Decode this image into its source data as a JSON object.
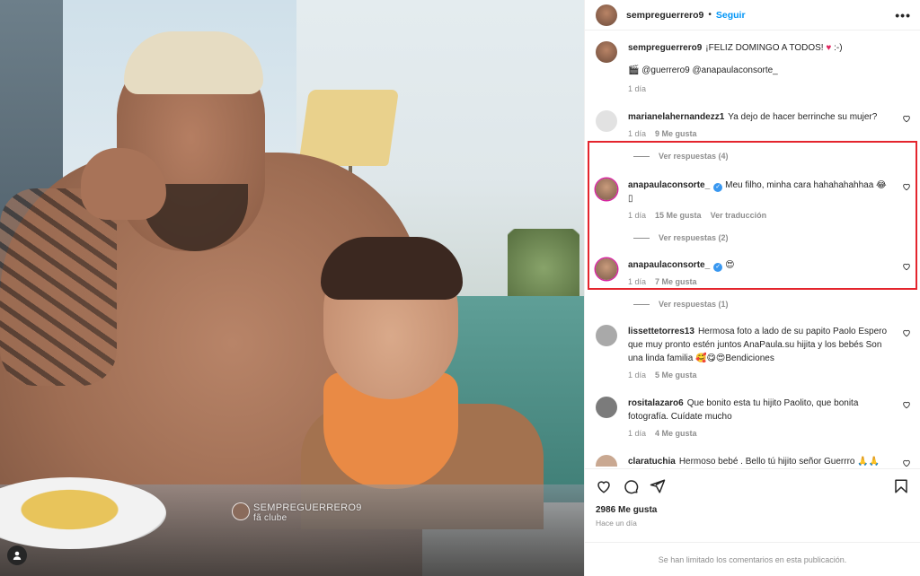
{
  "post": {
    "author": "sempreguerrero9",
    "follow_label": "Seguir",
    "more_label": "•••",
    "watermark_name": "SEMPREGUERRERO9",
    "watermark_sub": "fã clube"
  },
  "caption": {
    "user": "sempreguerrero9",
    "text": "¡FELIZ DOMINGO A TODOS! ",
    "emoji": "♥",
    "tail": " :-)",
    "mentions": "🎬 @guerrero9 @anapaulaconsorte_",
    "time": "1 día"
  },
  "comments": [
    {
      "user": "marianelahernandezz1",
      "text": "Ya dejo de hacer berrinche su mujer?",
      "time": "1 día",
      "likes": "9 Me gusta",
      "translate": "",
      "replies": "Ver respuestas (4)"
    },
    {
      "user": "anapaulaconsorte_",
      "verified": true,
      "text": "Meu filho, minha cara hahahahahhaa 😂",
      "text2": "▯",
      "time": "1 día",
      "likes": "15 Me gusta",
      "translate": "Ver traducción",
      "replies": "Ver respuestas (2)"
    },
    {
      "user": "anapaulaconsorte_",
      "verified": true,
      "text": "😍",
      "time": "1 día",
      "likes": "7 Me gusta",
      "translate": "",
      "replies": "Ver respuestas (1)"
    },
    {
      "user": "lissettetorres13",
      "text": "Hermosa foto a lado de su papito Paolo Espero que muy pronto estén juntos AnaPaula.su hijita y los bebés Son una linda familia 🥰😋😍Bendiciones",
      "time": "1 día",
      "likes": "5 Me gusta",
      "translate": "",
      "replies": ""
    },
    {
      "user": "rositalazaro6",
      "text": "Que bonito esta tu hijito Paolito, que bonita fotografía. Cuídate mucho",
      "time": "1 día",
      "likes": "4 Me gusta",
      "translate": "",
      "replies": ""
    },
    {
      "user": "claratuchia",
      "text": "Hermoso bebé . Bello tú hijito señor Guerrro 🙏🙏",
      "time": "",
      "likes": "",
      "translate": "",
      "replies": ""
    }
  ],
  "footer": {
    "likes": "2986 Me gusta",
    "time": "Hace un día",
    "limited": "Se han limitado los comentarios en esta publicación."
  },
  "colors": {
    "accent": "#0095f6",
    "highlight": "#e4252d",
    "heart": "#e0245e"
  },
  "icons": [
    "more-icon",
    "heart-icon",
    "comment-icon",
    "share-icon",
    "save-icon",
    "user-tag-icon",
    "verified-icon"
  ]
}
